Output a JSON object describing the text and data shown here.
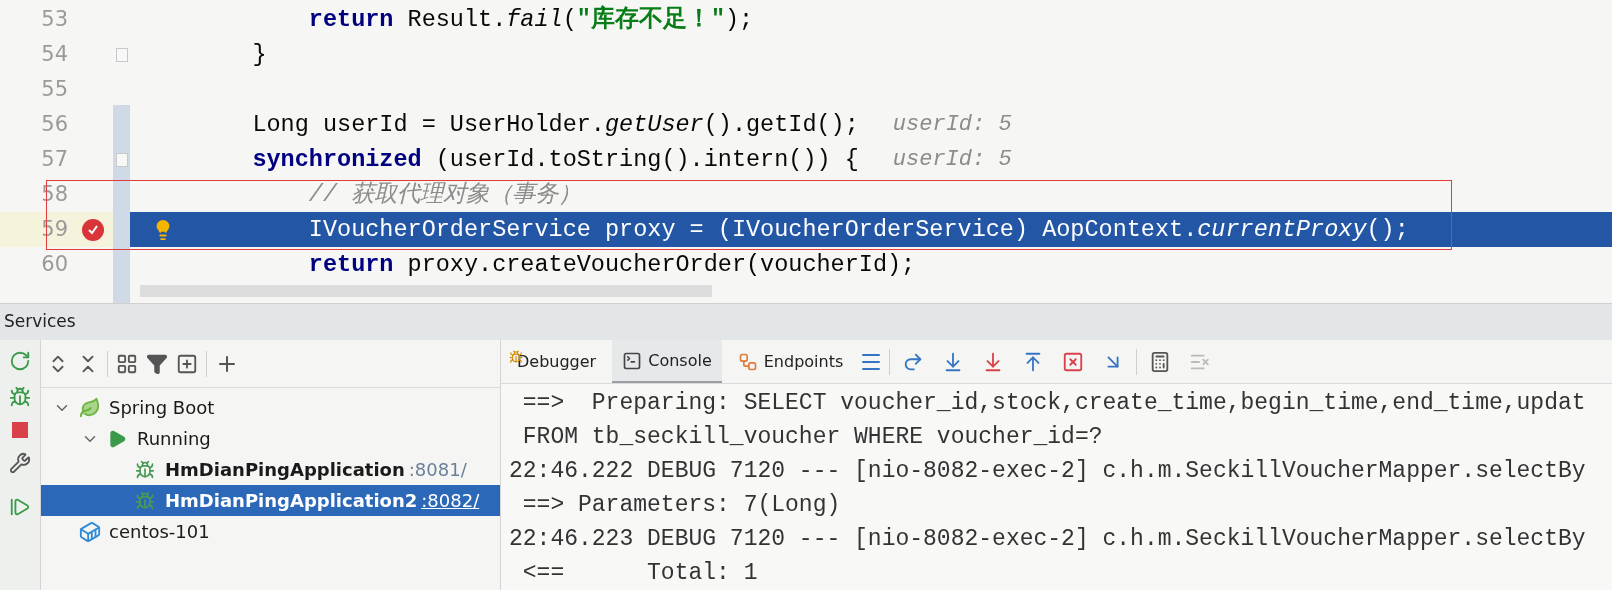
{
  "editor": {
    "lines": [
      {
        "number": "53",
        "selected": false,
        "tokens": [
          {
            "text": "        return",
            "kind": "keyword"
          },
          {
            "text": " Result.",
            "kind": "plain"
          },
          {
            "text": "fail",
            "kind": "italic"
          },
          {
            "text": "(",
            "kind": "plain"
          },
          {
            "text": "\"库存不足！\"",
            "kind": "string"
          },
          {
            "text": ");",
            "kind": "plain"
          }
        ]
      },
      {
        "number": "54",
        "selected": false,
        "fold": true,
        "tokens": [
          {
            "text": "    }",
            "kind": "plain"
          }
        ]
      },
      {
        "number": "55",
        "selected": false
      },
      {
        "number": "56",
        "selected": false,
        "hint": "userId: 5",
        "tokens": [
          {
            "text": "    Long userId = UserHolder.",
            "kind": "plain"
          },
          {
            "text": "getUser",
            "kind": "italic"
          },
          {
            "text": "().getId();",
            "kind": "plain"
          }
        ]
      },
      {
        "number": "57",
        "selected": false,
        "fold": true,
        "hint": "userId: 5",
        "tokens": [
          {
            "text": "    synchronized",
            "kind": "keyword"
          },
          {
            "text": " (userId.toString().intern()) {",
            "kind": "plain"
          }
        ]
      },
      {
        "number": "58",
        "selected": false,
        "tokens": [
          {
            "text": "        // 获取代理对象（事务）",
            "kind": "comment"
          }
        ]
      },
      {
        "number": "59",
        "selected": true,
        "breakpoint": true,
        "tokens": [
          {
            "text": "        IVoucherOrderService proxy = (IVoucherOrderService) AopContext.",
            "kind": "plain"
          },
          {
            "text": "currentProxy",
            "kind": "italic"
          },
          {
            "text": "();",
            "kind": "plain"
          }
        ]
      },
      {
        "number": "60",
        "selected": false,
        "tokens": [
          {
            "text": "        return",
            "kind": "keyword"
          },
          {
            "text": " proxy.createVoucherOrder(voucherId);",
            "kind": "plain"
          }
        ]
      }
    ]
  },
  "services": {
    "title": "Services",
    "tree": [
      {
        "label": "Spring Boot",
        "kind": "spring",
        "expanded": true,
        "children": [
          {
            "label": "Running",
            "kind": "running",
            "expanded": true,
            "children": [
              {
                "label": "HmDianPingApplication",
                "port": ":8081/",
                "kind": "app",
                "selected": false
              },
              {
                "label": "HmDianPingApplication2",
                "port": ":8082/",
                "kind": "app",
                "selected": true
              }
            ]
          }
        ]
      },
      {
        "label": "centos-101",
        "kind": "docker"
      }
    ],
    "tabs": [
      {
        "label": "Debugger",
        "kind": "debugger",
        "selected": false
      },
      {
        "label": "Console",
        "kind": "console",
        "selected": true
      },
      {
        "label": "Endpoints",
        "kind": "endpoints",
        "selected": false
      }
    ],
    "console": [
      " ==>  Preparing: SELECT voucher_id,stock,create_time,begin_time,end_time,updat",
      " FROM tb_seckill_voucher WHERE voucher_id=?",
      "22:46.222 DEBUG 7120 --- [nio-8082-exec-2] c.h.m.SeckillVoucherMapper.selectBy",
      " ==> Parameters: 7(Long)",
      "22:46.223 DEBUG 7120 --- [nio-8082-exec-2] c.h.m.SeckillVoucherMapper.selectBy",
      " <==      Total: 1"
    ]
  }
}
